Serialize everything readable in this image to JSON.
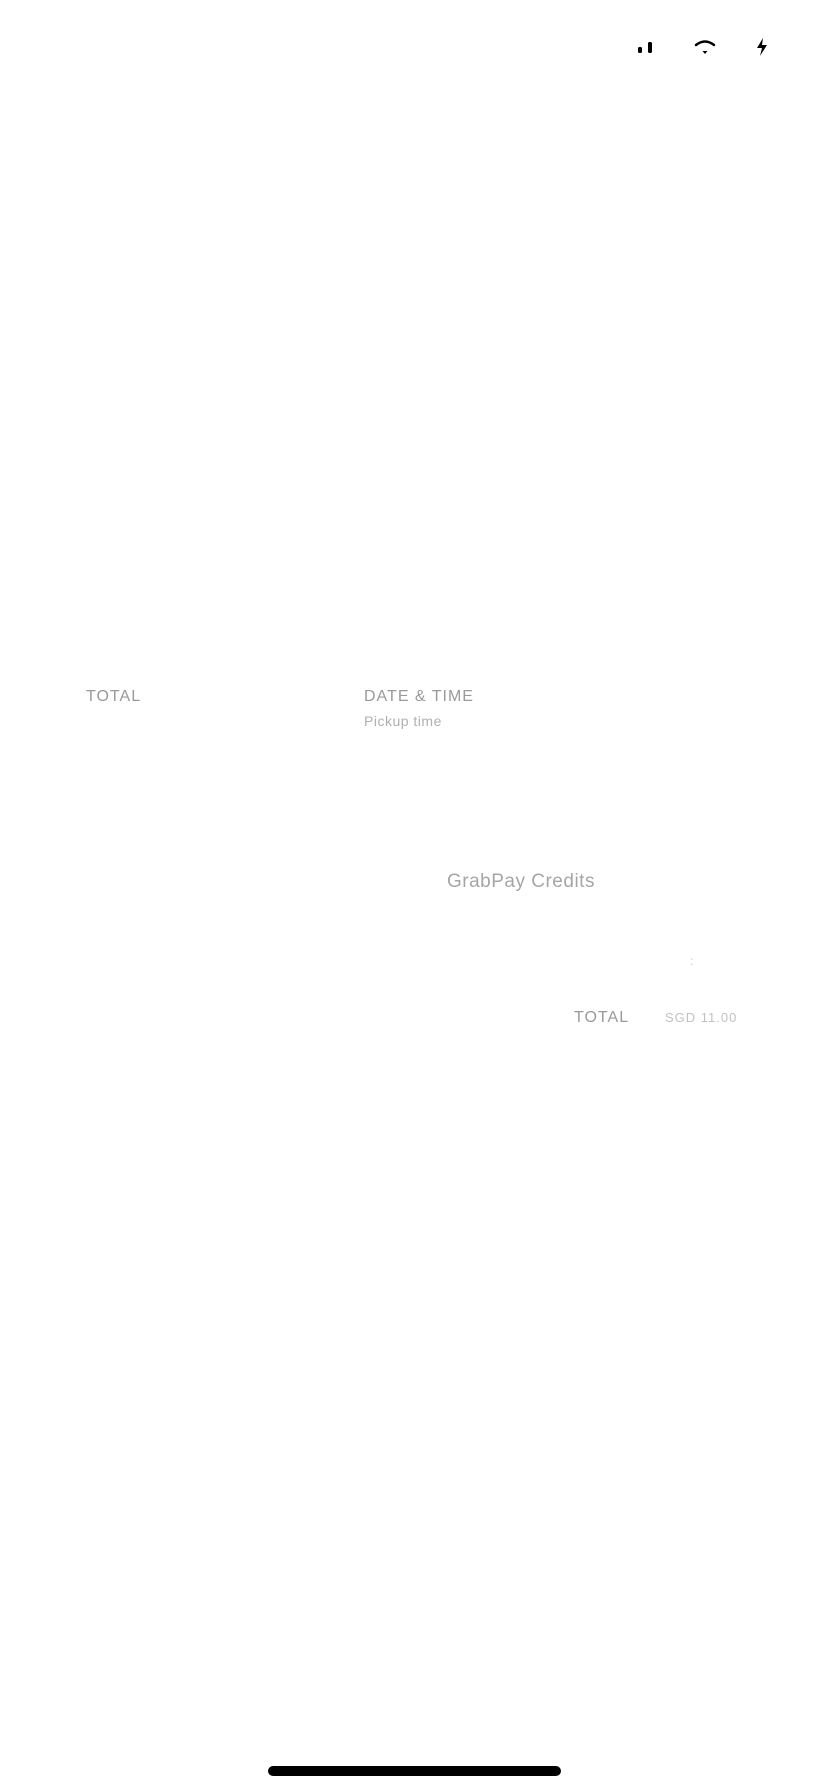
{
  "status_bar": {
    "icons": [
      "signal-icon",
      "wifi-icon",
      "battery-charging-icon"
    ]
  },
  "summary": {
    "total_label_left": "TOTAL",
    "date_time_label": "DATE & TIME",
    "pickup_label": "Pickup time"
  },
  "payment": {
    "method": "GrabPay Credits",
    "marker": ":",
    "total_label": "TOTAL",
    "total_amount": "SGD 11.00"
  }
}
